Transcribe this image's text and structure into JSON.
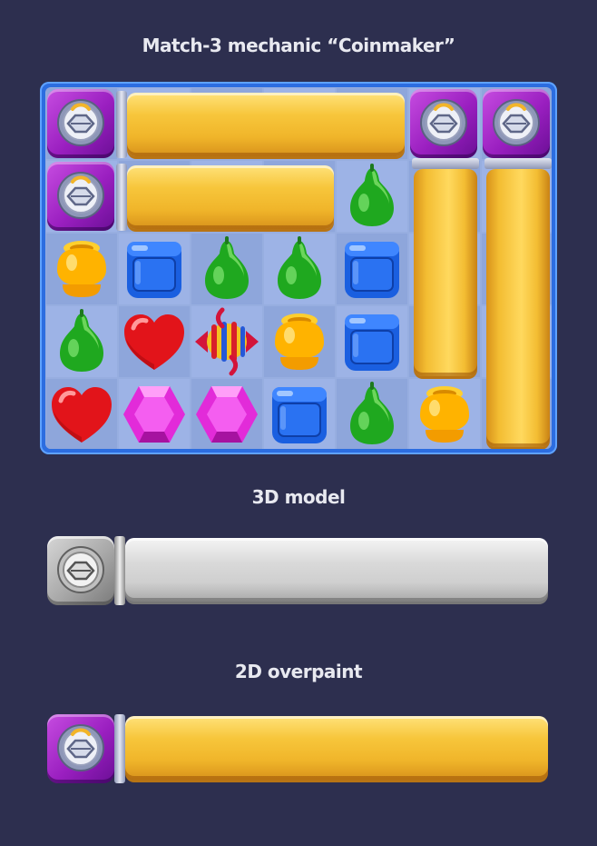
{
  "header": {
    "title": "Match-3 mechanic “Coinmaker”"
  },
  "section_3d": {
    "title": "3D model"
  },
  "section_2d": {
    "title": "2D overpaint"
  },
  "board": {
    "columns": 7,
    "rows": 5,
    "pieces": [
      {
        "row": 1,
        "col": 4,
        "type": "green-pear"
      },
      {
        "row": 2,
        "col": 0,
        "type": "yellow-cup"
      },
      {
        "row": 2,
        "col": 1,
        "type": "blue-jar"
      },
      {
        "row": 2,
        "col": 2,
        "type": "green-pear"
      },
      {
        "row": 2,
        "col": 3,
        "type": "green-pear"
      },
      {
        "row": 2,
        "col": 4,
        "type": "blue-jar"
      },
      {
        "row": 3,
        "col": 0,
        "type": "green-pear"
      },
      {
        "row": 3,
        "col": 1,
        "type": "red-heart"
      },
      {
        "row": 3,
        "col": 2,
        "type": "striped-candy"
      },
      {
        "row": 3,
        "col": 3,
        "type": "yellow-cup"
      },
      {
        "row": 3,
        "col": 4,
        "type": "blue-jar"
      },
      {
        "row": 4,
        "col": 0,
        "type": "red-heart"
      },
      {
        "row": 4,
        "col": 1,
        "type": "pink-hexagon"
      },
      {
        "row": 4,
        "col": 2,
        "type": "pink-hexagon"
      },
      {
        "row": 4,
        "col": 3,
        "type": "blue-jar"
      },
      {
        "row": 4,
        "col": 4,
        "type": "green-pear"
      },
      {
        "row": 4,
        "col": 5,
        "type": "yellow-cup"
      }
    ]
  },
  "colors": {
    "background": "#2d2f4f",
    "board_frame": "#2c6de0",
    "coin_bar": "#f7c63b",
    "lock_purple": "#9a1fc0",
    "model_grey": "#cfcfcf"
  }
}
